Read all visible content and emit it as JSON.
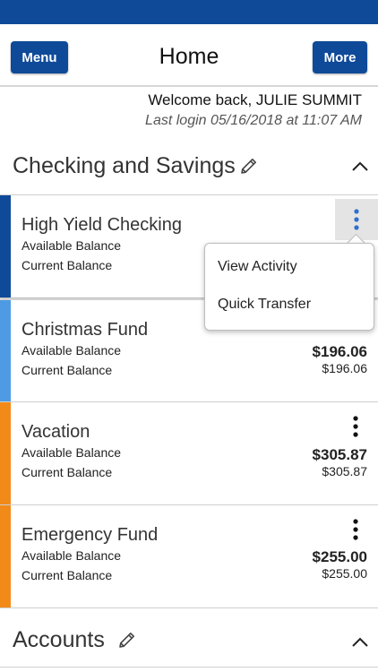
{
  "header": {
    "menu_label": "Menu",
    "title": "Home",
    "more_label": "More"
  },
  "welcome": {
    "line1": "Welcome back, JULIE SUMMIT",
    "line2": "Last login 05/16/2018 at 11:07 AM"
  },
  "sections": {
    "checking": "Checking and Savings",
    "accounts": "Accounts"
  },
  "labels": {
    "available": "Available Balance",
    "current": "Current Balance"
  },
  "accounts": [
    {
      "name": "High Yield Checking",
      "available": "",
      "current": "",
      "color": "#0f4a99"
    },
    {
      "name": "Christmas Fund",
      "available": "$196.06",
      "current": "$196.06",
      "color": "#4e9be3"
    },
    {
      "name": "Vacation",
      "available": "$305.87",
      "current": "$305.87",
      "color": "#f28a1a"
    },
    {
      "name": "Emergency Fund",
      "available": "$255.00",
      "current": "$255.00",
      "color": "#f28a1a"
    }
  ],
  "popup_menu": {
    "items": [
      "View Activity",
      "Quick Transfer"
    ]
  },
  "colors": {
    "brand": "#0f4a99",
    "kebab_blue": "#2f6fcf"
  },
  "icons": {
    "edit": "pencil-icon",
    "collapse": "chevron-up-icon",
    "more": "kebab-icon"
  }
}
